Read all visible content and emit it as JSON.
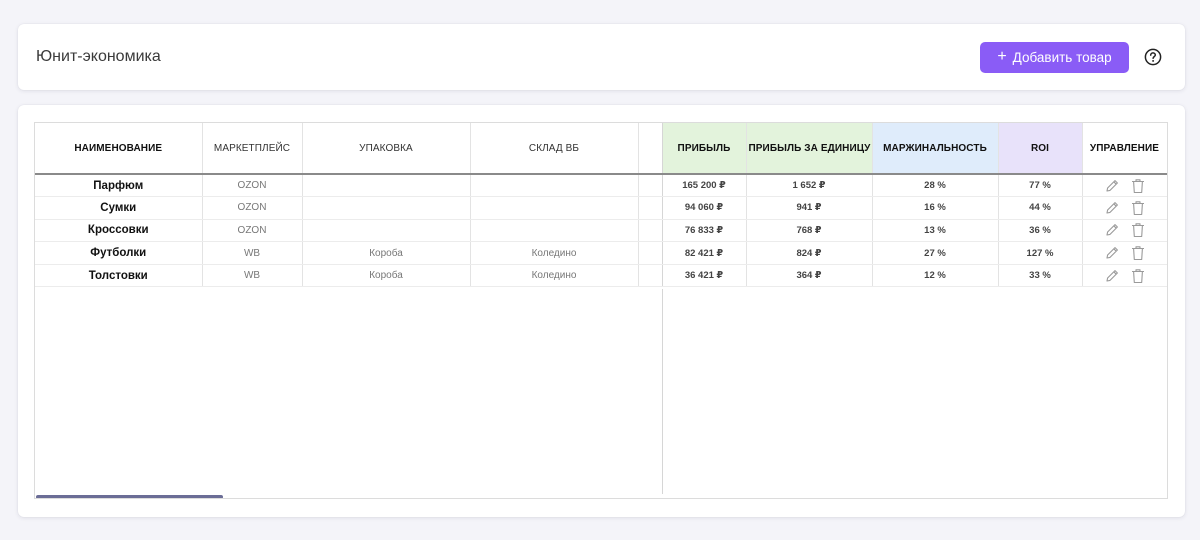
{
  "header": {
    "title": "Юнит-экономика",
    "add_button_label": "Добавить товар",
    "add_button_plus": "+",
    "accent_color": "#8a5cf6"
  },
  "table": {
    "columns": {
      "name": "НАИМЕНОВАНИЕ",
      "marketplace": "МАРКЕТПЛЕЙС",
      "packaging": "УПАКОВКА",
      "warehouse": "СКЛАД ВБ",
      "profit": "ПРИБЫЛЬ",
      "profit_per_unit": "ПРИБЫЛЬ ЗА ЕДИНИЦУ",
      "margin": "МАРЖИНАЛЬНОСТЬ",
      "roi": "ROI",
      "actions": "УПРАВЛЕНИЕ"
    },
    "rows": [
      {
        "name": "Парфюм",
        "marketplace": "OZON",
        "packaging": "",
        "warehouse": "",
        "profit": "165 200 ₽",
        "profit_per_unit": "1 652 ₽",
        "margin": "28 %",
        "roi": "77 %"
      },
      {
        "name": "Сумки",
        "marketplace": "OZON",
        "packaging": "",
        "warehouse": "",
        "profit": "94 060 ₽",
        "profit_per_unit": "941 ₽",
        "margin": "16 %",
        "roi": "44 %"
      },
      {
        "name": "Кроссовки",
        "marketplace": "OZON",
        "packaging": "",
        "warehouse": "",
        "profit": "76 833 ₽",
        "profit_per_unit": "768 ₽",
        "margin": "13 %",
        "roi": "36 %"
      },
      {
        "name": "Футболки",
        "marketplace": "WB",
        "packaging": "Короба",
        "warehouse": "Коледино",
        "profit": "82 421 ₽",
        "profit_per_unit": "824 ₽",
        "margin": "27 %",
        "roi": "127 %"
      },
      {
        "name": "Толстовки",
        "marketplace": "WB",
        "packaging": "Короба",
        "warehouse": "Коледино",
        "profit": "36 421 ₽",
        "profit_per_unit": "364 ₽",
        "margin": "12 %",
        "roi": "33 %"
      }
    ],
    "header_colors": {
      "profit": "#e3f3dc",
      "profit_per_unit": "#e3f3dc",
      "margin": "#dfecfb",
      "roi": "#e8e2fa"
    }
  },
  "icons": {
    "help": "question-circle-icon",
    "edit": "pencil-icon",
    "delete": "trash-icon",
    "add": "plus-icon"
  }
}
